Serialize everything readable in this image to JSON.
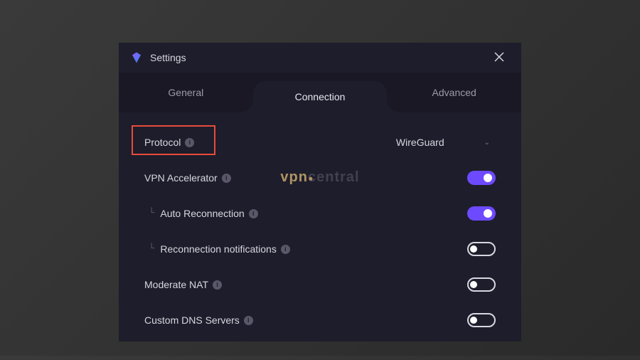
{
  "window": {
    "title": "Settings"
  },
  "tabs": {
    "general": "General",
    "connection": "Connection",
    "advanced": "Advanced",
    "active": "connection"
  },
  "settings": {
    "protocol": {
      "label": "Protocol",
      "value": "WireGuard"
    },
    "vpn_accelerator": {
      "label": "VPN Accelerator",
      "enabled": true
    },
    "auto_reconnection": {
      "label": "Auto Reconnection",
      "enabled": true
    },
    "reconnection_notifications": {
      "label": "Reconnection notifications",
      "enabled": false
    },
    "moderate_nat": {
      "label": "Moderate NAT",
      "enabled": false
    },
    "custom_dns": {
      "label": "Custom DNS Servers",
      "enabled": false
    }
  },
  "watermark": {
    "part1": "vpn",
    "part2": "central"
  },
  "colors": {
    "accent": "#6d4aff",
    "highlight": "#e74c3c",
    "bg_window": "#1e1d2b",
    "bg_tabs": "#191824"
  }
}
